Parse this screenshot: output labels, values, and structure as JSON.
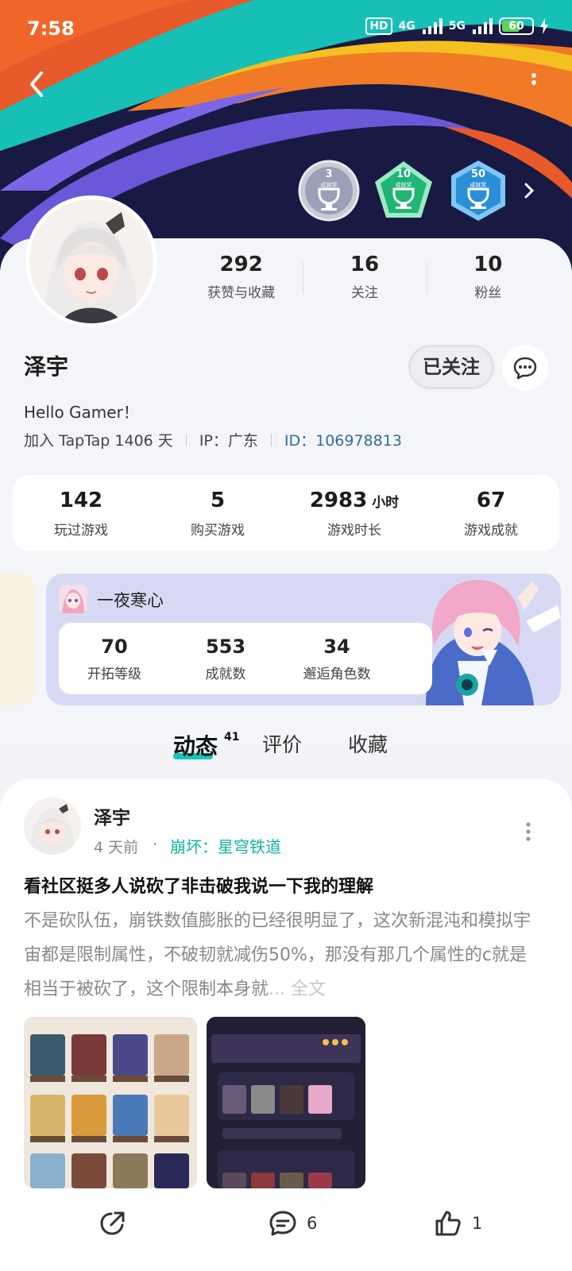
{
  "status_bar": {
    "time": "7:58",
    "hd": "HD",
    "net1": "4G",
    "net2": "5G",
    "battery_level": 60,
    "battery_text": "60"
  },
  "header": {
    "badges": [
      {
        "num": "3",
        "sub": "成就奖",
        "color": "#9aa0b8"
      },
      {
        "num": "10",
        "sub": "成就奖",
        "color": "#1fb574"
      },
      {
        "num": "50",
        "sub": "成就奖",
        "color": "#2a8fd6"
      }
    ]
  },
  "profile": {
    "stats": [
      {
        "value": "292",
        "label": "获赞与收藏"
      },
      {
        "value": "16",
        "label": "关注"
      },
      {
        "value": "10",
        "label": "粉丝"
      }
    ],
    "name": "泽宇",
    "follow_label": "已关注",
    "bio": "Hello Gamer！",
    "joined": "加入 TapTap 1406 天",
    "ip": "IP：广东",
    "id": "ID：106978813"
  },
  "game_stats": [
    {
      "value": "142",
      "unit": "",
      "label": "玩过游戏"
    },
    {
      "value": "5",
      "unit": "",
      "label": "购买游戏"
    },
    {
      "value": "2983",
      "unit": "小时",
      "label": "游戏时长"
    },
    {
      "value": "67",
      "unit": "",
      "label": "游戏成就"
    }
  ],
  "game_card": {
    "title": "一夜寒心",
    "stats": [
      {
        "value": "70",
        "label": "开拓等级"
      },
      {
        "value": "553",
        "label": "成就数"
      },
      {
        "value": "34",
        "label": "邂逅角色数"
      }
    ]
  },
  "tabs": {
    "items": [
      "动态",
      "评价",
      "收藏"
    ],
    "active_count": "41"
  },
  "post": {
    "author": "泽宇",
    "time": "4 天前",
    "dot": "·",
    "game": "崩坏：星穹铁道",
    "title": "看社区挺多人说砍了非击破我说一下我的理解",
    "body": "不是砍队伍，崩铁数值膨胀的已经很明显了，这次新混沌和模拟宇宙都是限制属性，不破韧就减伤50%，那没有那几个属性的c就是相当于被砍了，这个限制本身就",
    "more": "... 全文",
    "comments": "6",
    "likes": "1"
  },
  "colors": {
    "accent": "#12c9b6",
    "id_link": "#2e6f9a"
  }
}
